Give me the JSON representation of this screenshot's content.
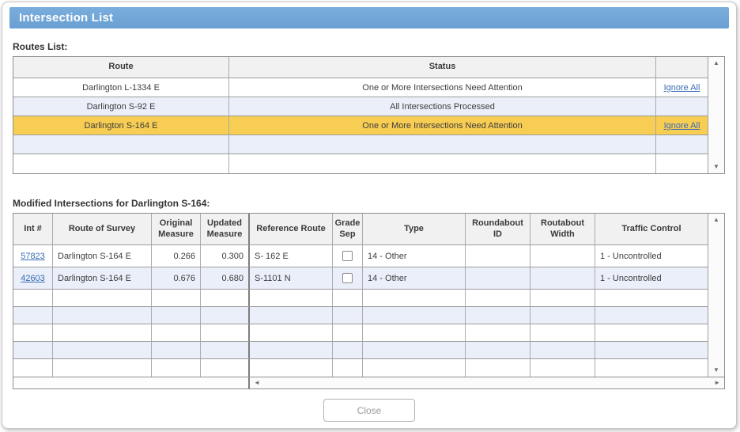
{
  "window": {
    "title": "Intersection List"
  },
  "colors": {
    "titlebar_top": "#7aaedd",
    "titlebar_bottom": "#699fd2",
    "selected_row": "#f7cd53",
    "alt_row": "#eaeff9",
    "header_bg": "#f1f1f1",
    "link": "#3a6cb5"
  },
  "icons": {
    "scroll_up": "▲",
    "scroll_down": "▼",
    "scroll_left": "◄",
    "scroll_right": "►"
  },
  "routes_section": {
    "label": "Routes List:",
    "columns": [
      "Route",
      "Status",
      ""
    ],
    "rows": [
      {
        "route": "Darlington L-1334 E",
        "status": "One or More Intersections Need Attention",
        "action": "Ignore All",
        "selected": false
      },
      {
        "route": "Darlington S-92 E",
        "status": "All Intersections Processed",
        "action": "",
        "selected": false
      },
      {
        "route": "Darlington S-164 E",
        "status": "One or More Intersections Need Attention",
        "action": "Ignore All",
        "selected": true
      },
      {
        "route": "",
        "status": "",
        "action": "",
        "selected": false
      },
      {
        "route": "",
        "status": "",
        "action": "",
        "selected": false
      }
    ]
  },
  "intersections_section": {
    "label": "Modified Intersections for Darlington S-164:",
    "columns": [
      "Int #",
      "Route of Survey",
      "Original Measure",
      "Updated Measure",
      "Reference Route",
      "Grade Sep",
      "Type",
      "Roundabout ID",
      "Routabout Width",
      "Traffic Control"
    ],
    "rows": [
      {
        "int_no": "57823",
        "route_of_survey": "Darlington S-164 E",
        "original_measure": "0.266",
        "updated_measure": "0.300",
        "reference_route": "S- 162 E",
        "grade_sep": false,
        "type": "14 - Other",
        "roundabout_id": "",
        "routabout_width": "",
        "traffic_control": "1 - Uncontrolled"
      },
      {
        "int_no": "42603",
        "route_of_survey": "Darlington S-164 E",
        "original_measure": "0.676",
        "updated_measure": "0.680",
        "reference_route": "S-1101 N",
        "grade_sep": false,
        "type": "14 - Other",
        "roundabout_id": "",
        "routabout_width": "",
        "traffic_control": "1 - Uncontrolled"
      }
    ],
    "empty_rows": 5
  },
  "footer": {
    "close_label": "Close"
  }
}
